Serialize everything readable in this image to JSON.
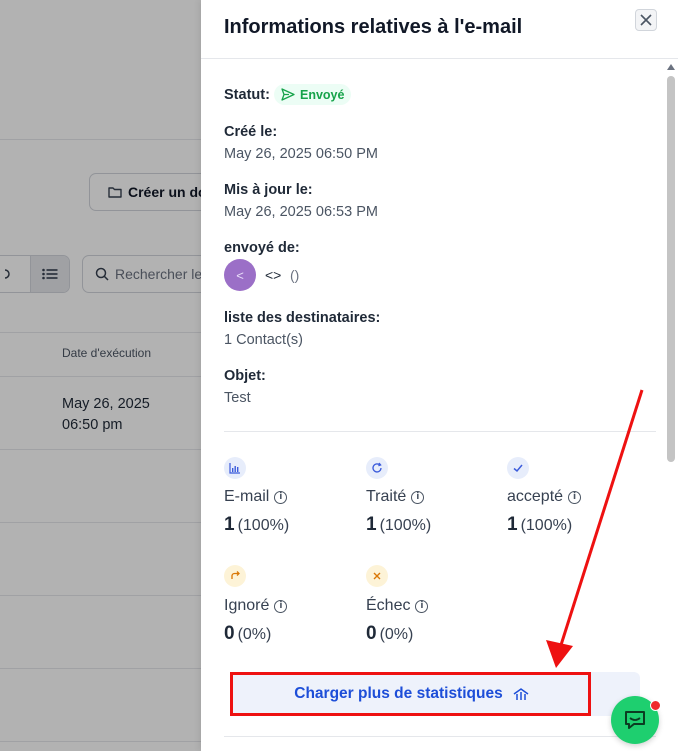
{
  "background": {
    "create_button_label": "Créer un do",
    "search_placeholder": "Rechercher le",
    "column_header": "Date d'exécution",
    "row_date_line1": "May 26, 2025",
    "row_date_line2": "06:50 pm"
  },
  "drawer": {
    "title": "Informations relatives à l'e-mail",
    "status_label": "Statut:",
    "status_value": "Envoyé",
    "created_label": "Créé le:",
    "created_value": "May 26, 2025 06:50 PM",
    "updated_label": "Mis à jour le:",
    "updated_value": "May 26, 2025 06:53 PM",
    "sent_from_label": "envoyé de:",
    "sender_avatar_text": "<",
    "sender_email": "<>",
    "sender_name": "()",
    "recipients_label": "liste des destinataires:",
    "recipients_value": "1 Contact(s)",
    "subject_label": "Objet:",
    "subject_value": "Test"
  },
  "stats": [
    {
      "label": "E-mail",
      "count": "1",
      "pct": "(100%)",
      "icon": "bar-chart-icon",
      "color": "#3b5bdb",
      "bg": "#e7edfb"
    },
    {
      "label": "Traité",
      "count": "1",
      "pct": "(100%)",
      "icon": "refresh-icon",
      "color": "#3b5bdb",
      "bg": "#e7edfb"
    },
    {
      "label": "accepté",
      "count": "1",
      "pct": "(100%)",
      "icon": "check-icon",
      "color": "#3b5bdb",
      "bg": "#e7edfb"
    },
    {
      "label": "Ignoré",
      "count": "0",
      "pct": "(0%)",
      "icon": "redo-icon",
      "color": "#d97706",
      "bg": "#fdf3d7"
    },
    {
      "label": "Échec",
      "count": "0",
      "pct": "(0%)",
      "icon": "x-icon",
      "color": "#d97706",
      "bg": "#fdf3d7"
    }
  ],
  "load_more_label": "Charger plus de statistiques",
  "colors": {
    "accent": "#1d4ed8",
    "status_green": "#16a34a",
    "annotation_red": "#ee1111",
    "chat_green": "#1ecf6f"
  }
}
